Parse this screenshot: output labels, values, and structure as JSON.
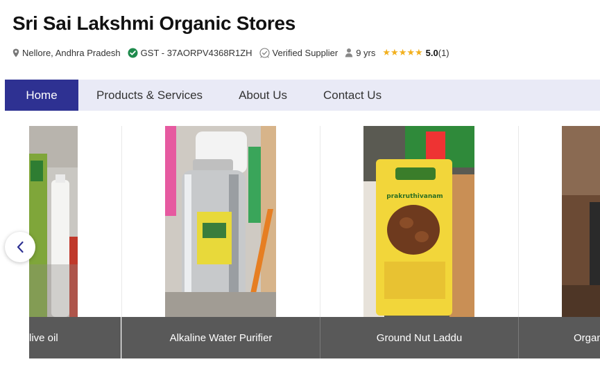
{
  "store": {
    "name": "Sri Sai Lakshmi Organic Stores",
    "location": "Nellore, Andhra Pradesh",
    "gst": "GST - 37AORPV4368R1ZH",
    "verified": "Verified Supplier",
    "years": "9 yrs",
    "stars": "★★★★★",
    "rating": "5.0",
    "rating_count": "(1)"
  },
  "nav": {
    "tabs": [
      {
        "label": "Home",
        "active": true
      },
      {
        "label": "Products & Services",
        "active": false
      },
      {
        "label": "About Us",
        "active": false
      },
      {
        "label": "Contact Us",
        "active": false
      }
    ]
  },
  "carousel": {
    "items": [
      {
        "caption": "live oil"
      },
      {
        "caption": "Alkaline Water Purifier"
      },
      {
        "caption": "Ground Nut Laddu"
      },
      {
        "caption": "Organ"
      }
    ],
    "packet_brand": "prakruthivanam"
  },
  "colors": {
    "nav_active": "#2e3192",
    "nav_bg": "#e9eaf6",
    "star": "#f2b01e",
    "verified_green": "#1e8a4c",
    "caption_bg": "#595959"
  },
  "icons": [
    "location-pin-icon",
    "verified-badge-icon",
    "verified-supplier-icon",
    "person-icon",
    "chevron-left-icon"
  ]
}
